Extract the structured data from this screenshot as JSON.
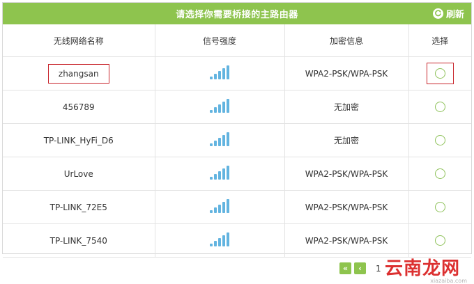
{
  "header": {
    "title": "请选择你需要桥接的主路由器",
    "refresh_label": "刷新",
    "background_color": "#8ec44e"
  },
  "table": {
    "columns": [
      "无线网络名称",
      "信号强度",
      "加密信息",
      "选择"
    ],
    "rows": [
      {
        "ssid": "zhangsan",
        "signal_level": 5,
        "encryption": "WPA2-PSK/WPA-PSK",
        "highlighted": true
      },
      {
        "ssid": "456789",
        "signal_level": 5,
        "encryption": "无加密",
        "highlighted": false
      },
      {
        "ssid": "TP-LINK_HyFi_D6",
        "signal_level": 5,
        "encryption": "无加密",
        "highlighted": false
      },
      {
        "ssid": "UrLove",
        "signal_level": 5,
        "encryption": "WPA2-PSK/WPA-PSK",
        "highlighted": false
      },
      {
        "ssid": "TP-LINK_72E5",
        "signal_level": 5,
        "encryption": "WPA2-PSK/WPA-PSK",
        "highlighted": false
      },
      {
        "ssid": "TP-LINK_7540",
        "signal_level": 5,
        "encryption": "WPA2-PSK/WPA-PSK",
        "highlighted": false
      }
    ]
  },
  "pagination": {
    "first_icon": "double-chevron-left-icon",
    "prev_icon": "chevron-left-icon",
    "current_page": "1"
  },
  "watermark": {
    "text": "云南龙网",
    "sub": "xiazaiba.com"
  },
  "colors": {
    "accent": "#8ec44e",
    "signal": "#63b4e0",
    "highlight_border": "#c8242b"
  }
}
